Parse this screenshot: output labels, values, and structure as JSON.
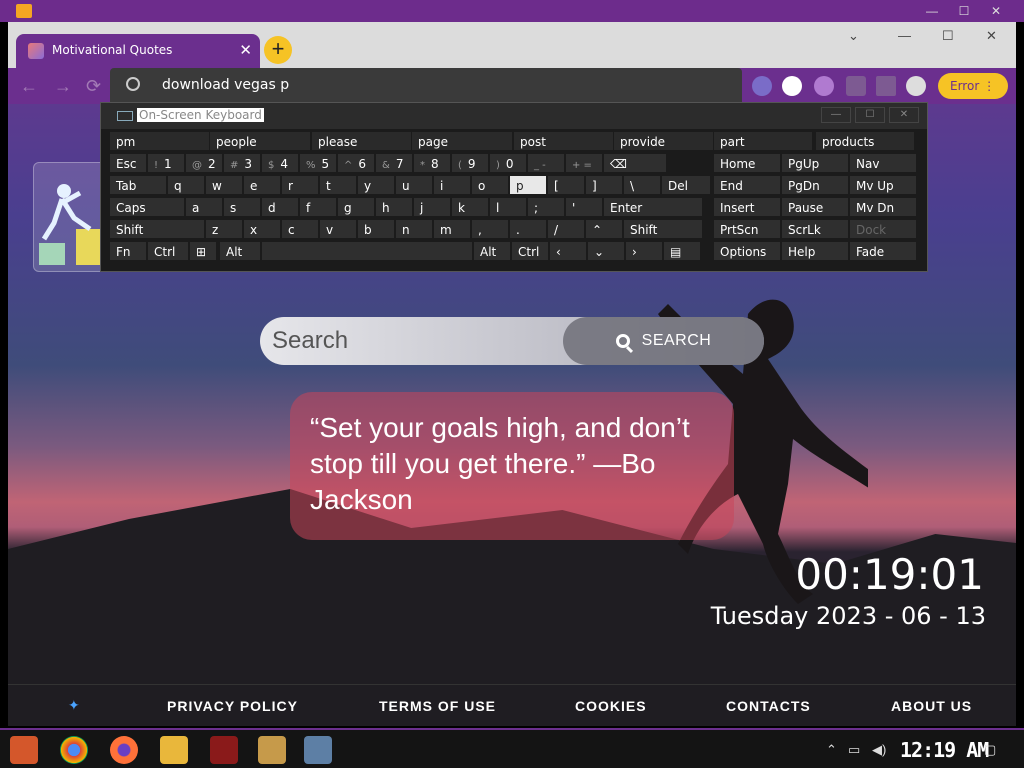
{
  "browser": {
    "tab_title": "Motivational Quotes",
    "address_text": "download vegas p",
    "error_label": "Error"
  },
  "osk": {
    "title": "On-Screen Keyboard",
    "suggestions": [
      "pm",
      "people",
      "please",
      "page",
      "post",
      "provide",
      "part",
      "products"
    ],
    "row1": [
      "Esc",
      "1",
      "2",
      "3",
      "4",
      "5",
      "6",
      "7",
      "8",
      "9",
      "0",
      "Home",
      "PgUp",
      "Nav"
    ],
    "row1_sub": [
      "~ `",
      "!",
      "@",
      "#",
      "$",
      "%",
      "^",
      "&",
      "*",
      "(",
      ")",
      "_ -",
      "+ ="
    ],
    "row2": [
      "Tab",
      "q",
      "w",
      "e",
      "r",
      "t",
      "y",
      "u",
      "i",
      "o",
      "p",
      "[",
      "]",
      "\\",
      "Del",
      "End",
      "PgDn",
      "Mv Up"
    ],
    "row3": [
      "Caps",
      "a",
      "s",
      "d",
      "f",
      "g",
      "h",
      "j",
      "k",
      "l",
      ";",
      "'",
      "Enter",
      "Insert",
      "Pause",
      "Mv Dn"
    ],
    "row4": [
      "Shift",
      "z",
      "x",
      "c",
      "v",
      "b",
      "n",
      "m",
      ",",
      ".",
      "/",
      "Shift",
      "PrtScn",
      "ScrLk",
      "Dock"
    ],
    "row5": [
      "Fn",
      "Ctrl",
      "Alt",
      "Alt",
      "Ctrl",
      "Options",
      "Help",
      "Fade"
    ]
  },
  "page": {
    "search_placeholder": "Search",
    "search_button": "SEARCH",
    "quote": "“Set your goals high, and don’t stop till you get there.” —Bo Jackson",
    "time": "00:19:01",
    "date": "Tuesday 2023 - 06 - 13"
  },
  "footer": {
    "links": [
      "PRIVACY POLICY",
      "TERMS OF USE",
      "COOKIES",
      "CONTACTS",
      "ABOUT US"
    ]
  },
  "taskbar": {
    "clock": "12:19 AM"
  },
  "colors": {
    "brand_purple": "#6b2f8e",
    "accent_yellow": "#f6c325"
  }
}
